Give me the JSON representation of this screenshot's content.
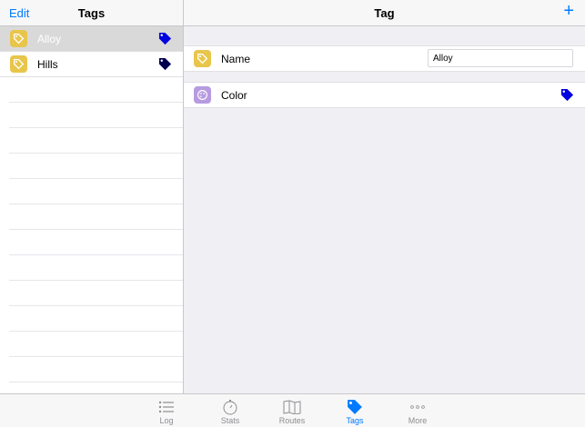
{
  "master": {
    "edit_label": "Edit",
    "title": "Tags",
    "items": [
      {
        "label": "Alloy",
        "tag_color": "#0000e0",
        "selected": true
      },
      {
        "label": "Hills",
        "tag_color": "#000050",
        "selected": false
      }
    ]
  },
  "detail": {
    "title": "Tag",
    "add_label": "+",
    "name_label": "Name",
    "name_value": "Alloy",
    "color_label": "Color",
    "color_value": "#0000e0"
  },
  "tabbar": {
    "tabs": [
      {
        "label": "Log",
        "icon": "list-icon",
        "active": false
      },
      {
        "label": "Stats",
        "icon": "stopwatch-icon",
        "active": false
      },
      {
        "label": "Routes",
        "icon": "map-icon",
        "active": false
      },
      {
        "label": "Tags",
        "icon": "tag-icon",
        "active": true
      },
      {
        "label": "More",
        "icon": "more-icon",
        "active": false
      }
    ]
  },
  "colors": {
    "accent": "#007aff",
    "tag_icon_bg": "#e8c54b",
    "color_icon_bg": "#b79be0"
  }
}
